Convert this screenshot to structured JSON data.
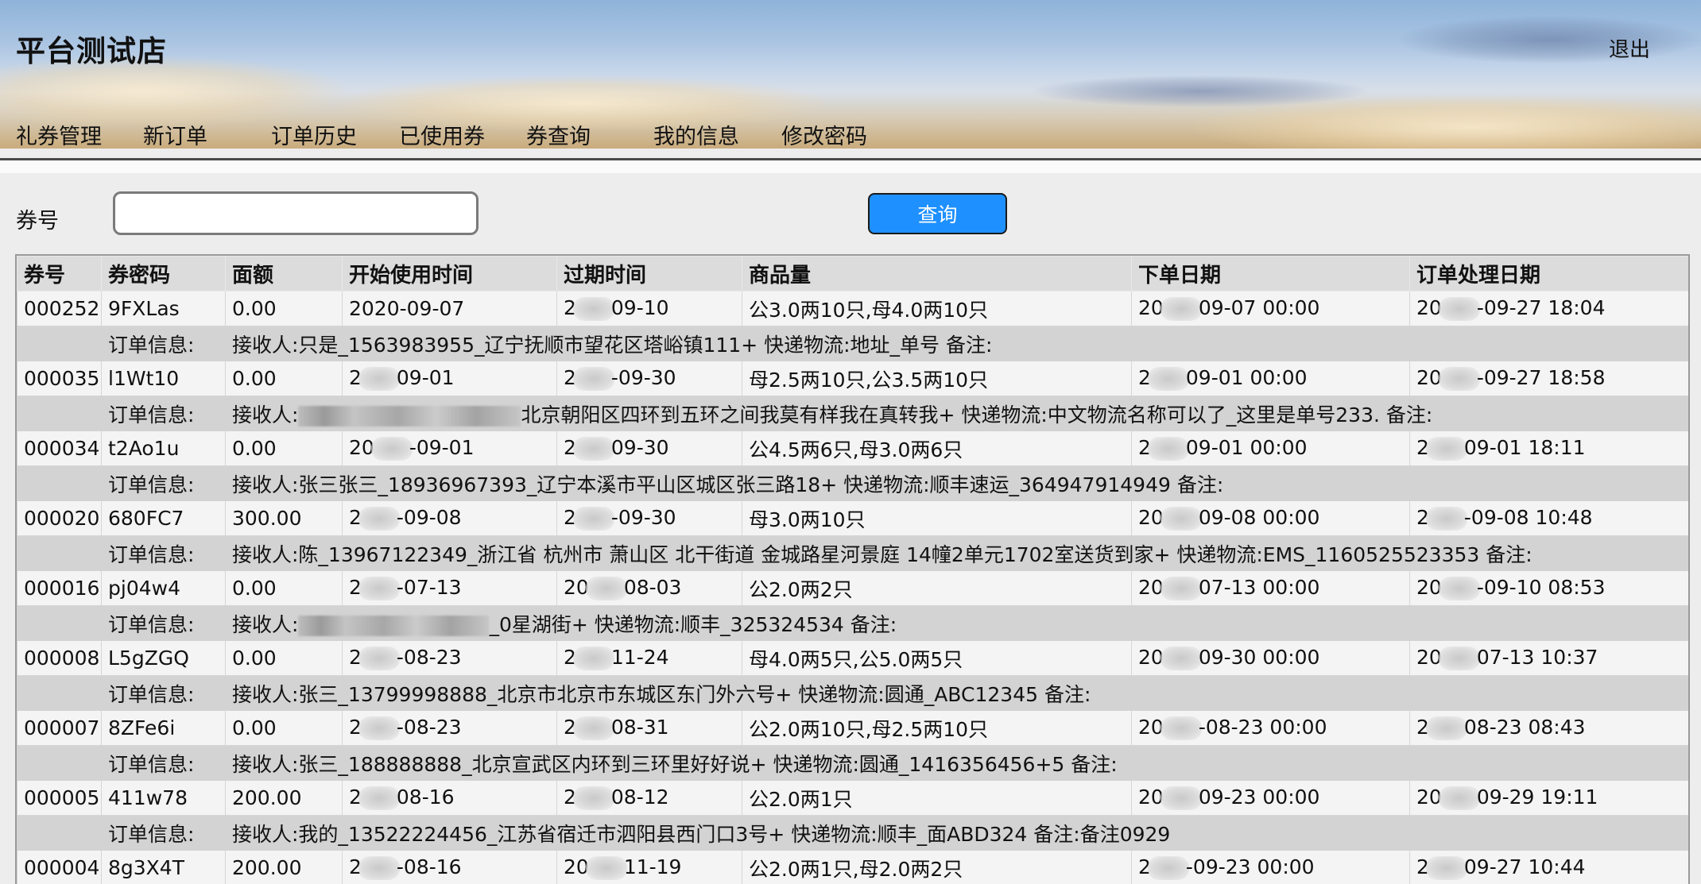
{
  "header": {
    "title": "平台测试店",
    "logout_label": "退出"
  },
  "nav": {
    "items": [
      "礼券管理",
      "新订单",
      "订单历史",
      "已使用券",
      "券查询",
      "我的信息",
      "修改密码"
    ]
  },
  "search": {
    "label": "券号",
    "value": "",
    "button_label": "查询"
  },
  "table": {
    "headers": [
      "券号",
      "券密码",
      "面额",
      "开始使用时间",
      "过期时间",
      "商品量",
      "下单日期",
      "订单处理日期"
    ],
    "info_label": "订单信息:",
    "rows": [
      {
        "code": "000252",
        "pwd": "9FXLas",
        "amount": "0.00",
        "start": {
          "a": "2020-09-07",
          "b": ""
        },
        "expire": {
          "a": "2",
          "b": "09-10"
        },
        "goods": "公3.0两10只,母4.0两10只",
        "ordered": {
          "a": "20",
          "b": "09-07 00:00"
        },
        "processed": {
          "a": "20",
          "b": "-09-27 18:04"
        },
        "info": {
          "pre": "接收人:只是_1563983955_辽宁抚顺市望花区塔峪镇111+ 快递物流:地址_单号 备注:",
          "post": ""
        }
      },
      {
        "code": "000035",
        "pwd": "l1Wt10",
        "amount": "0.00",
        "start": {
          "a": "2",
          "b": "09-01"
        },
        "expire": {
          "a": "2",
          "b": "-09-30"
        },
        "goods": "母2.5两10只,公3.5两10只",
        "ordered": {
          "a": "2",
          "b": "09-01 00:00"
        },
        "processed": {
          "a": "20",
          "b": "-09-27 18:58"
        },
        "info": {
          "pre": "接收人:",
          "post": "北京朝阳区四环到五环之间我莫有样我在真转我+ 快递物流:中文物流名称可以了_这里是单号233. 备注:"
        }
      },
      {
        "code": "000034",
        "pwd": "t2Ao1u",
        "amount": "0.00",
        "start": {
          "a": "20",
          "b": "-09-01"
        },
        "expire": {
          "a": "2",
          "b": "09-30"
        },
        "goods": "公4.5两6只,母3.0两6只",
        "ordered": {
          "a": "2",
          "b": "09-01 00:00"
        },
        "processed": {
          "a": "2",
          "b": "09-01 18:11"
        },
        "info": {
          "pre": "接收人:张三张三_18936967393_辽宁本溪市平山区城区张三路18+ 快递物流:顺丰速运_364947914949 备注:",
          "post": ""
        }
      },
      {
        "code": "000020",
        "pwd": "680FC7",
        "amount": "300.00",
        "start": {
          "a": "2",
          "b": "-09-08"
        },
        "expire": {
          "a": "2",
          "b": "-09-30"
        },
        "goods": "母3.0两10只",
        "ordered": {
          "a": "20",
          "b": "09-08 00:00"
        },
        "processed": {
          "a": "2",
          "b": "-09-08 10:48"
        },
        "info": {
          "pre": "接收人:陈_13967122349_浙江省 杭州市 萧山区 北干街道 金城路星河景庭 14幢2单元1702室送货到家+ 快递物流:EMS_1160525523353 备注:",
          "post": ""
        }
      },
      {
        "code": "000016",
        "pwd": "pj04w4",
        "amount": "0.00",
        "start": {
          "a": "2",
          "b": "-07-13"
        },
        "expire": {
          "a": "20",
          "b": "08-03"
        },
        "goods": "公2.0两2只",
        "ordered": {
          "a": "20",
          "b": "07-13 00:00"
        },
        "processed": {
          "a": "20",
          "b": "-09-10 08:53"
        },
        "info": {
          "pre": "接收人:",
          "post": "_0星湖街+ 快递物流:顺丰_325324534 备注:"
        }
      },
      {
        "code": "000008",
        "pwd": "L5gZGQ",
        "amount": "0.00",
        "start": {
          "a": "2",
          "b": "-08-23"
        },
        "expire": {
          "a": "2",
          "b": "11-24"
        },
        "goods": "母4.0两5只,公5.0两5只",
        "ordered": {
          "a": "20",
          "b": "09-30 00:00"
        },
        "processed": {
          "a": "20",
          "b": "07-13 10:37"
        },
        "info": {
          "pre": "接收人:张三_13799998888_北京市北京市东城区东门外六号+ 快递物流:圆通_ABC12345 备注:",
          "post": ""
        }
      },
      {
        "code": "000007",
        "pwd": "8ZFe6i",
        "amount": "0.00",
        "start": {
          "a": "2",
          "b": "-08-23"
        },
        "expire": {
          "a": "2",
          "b": "08-31"
        },
        "goods": "公2.0两10只,母2.5两10只",
        "ordered": {
          "a": "20",
          "b": "-08-23 00:00"
        },
        "processed": {
          "a": "2",
          "b": "08-23 08:43"
        },
        "info": {
          "pre": "接收人:张三_188888888_北京宣武区内环到三环里好好说+ 快递物流:圆通_1416356456+5 备注:",
          "post": ""
        }
      },
      {
        "code": "000005",
        "pwd": "411w78",
        "amount": "200.00",
        "start": {
          "a": "2",
          "b": "08-16"
        },
        "expire": {
          "a": "2",
          "b": "08-12"
        },
        "goods": "公2.0两1只",
        "ordered": {
          "a": "20",
          "b": "09-23 00:00"
        },
        "processed": {
          "a": "20",
          "b": "09-29 19:11"
        },
        "info": {
          "pre": "接收人:我的_13522224456_江苏省宿迁市泗阳县西门口3号+ 快递物流:顺丰_面ABD324 备注:备注0929",
          "post": ""
        }
      },
      {
        "code": "000004",
        "pwd": "8g3X4T",
        "amount": "200.00",
        "start": {
          "a": "2",
          "b": "-08-16"
        },
        "expire": {
          "a": "20",
          "b": "11-19"
        },
        "goods": "公2.0两1只,母2.0两2只",
        "ordered": {
          "a": "2",
          "b": "-09-23 00:00"
        },
        "processed": {
          "a": "2",
          "b": "09-27 10:44"
        },
        "info": {
          "pre": "",
          "post": ""
        }
      }
    ]
  }
}
